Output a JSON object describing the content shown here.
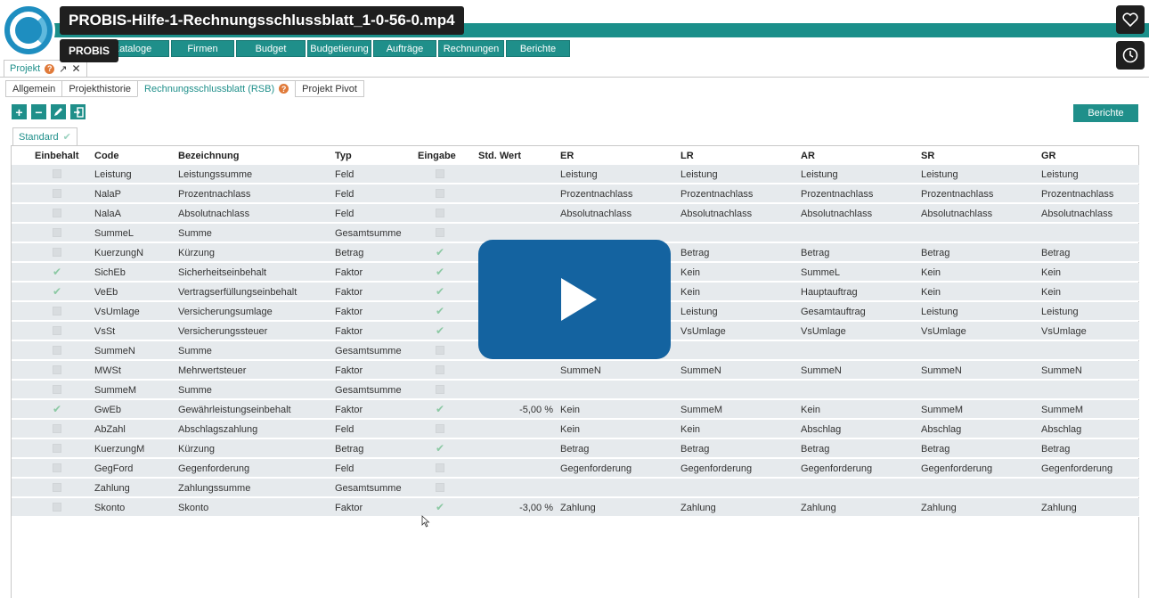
{
  "video": {
    "title": "PROBIS-Hilfe-1-Rechnungsschlussblatt_1-0-56-0.mp4",
    "channel": "PROBIS"
  },
  "nav": [
    "Kataloge",
    "Firmen",
    "Budget",
    "Budgetierung",
    "Aufträge",
    "Rechnungen",
    "Berichte"
  ],
  "doc_tab": {
    "label": "Projekt",
    "help": "?"
  },
  "subtabs": [
    {
      "label": "Allgemein"
    },
    {
      "label": "Projekthistorie"
    },
    {
      "label": "Rechnungsschlussblatt (RSB)",
      "help": "?"
    },
    {
      "label": "Projekt Pivot"
    }
  ],
  "toolbar": {
    "berichte": "Berichte"
  },
  "view_tab": {
    "label": "Standard"
  },
  "columns": [
    "Einbehalt",
    "Code",
    "Bezeichnung",
    "Typ",
    "Eingabe",
    "Std. Wert",
    "ER",
    "LR",
    "AR",
    "SR",
    "GR"
  ],
  "rows": [
    {
      "einbehalt": false,
      "code": "Leistung",
      "bez": "Leistungssumme",
      "typ": "Feld",
      "eingabe": false,
      "std": "",
      "er": "Leistung",
      "lr": "Leistung",
      "ar": "Leistung",
      "sr": "Leistung",
      "gr": "Leistung"
    },
    {
      "einbehalt": false,
      "code": "NalaP",
      "bez": "Prozentnachlass",
      "typ": "Feld",
      "eingabe": false,
      "std": "",
      "er": "Prozentnachlass",
      "lr": "Prozentnachlass",
      "ar": "Prozentnachlass",
      "sr": "Prozentnachlass",
      "gr": "Prozentnachlass"
    },
    {
      "einbehalt": false,
      "code": "NalaA",
      "bez": "Absolutnachlass",
      "typ": "Feld",
      "eingabe": false,
      "std": "",
      "er": "Absolutnachlass",
      "lr": "Absolutnachlass",
      "ar": "Absolutnachlass",
      "sr": "Absolutnachlass",
      "gr": "Absolutnachlass"
    },
    {
      "einbehalt": false,
      "code": "SummeL",
      "bez": "Summe",
      "typ": "Gesamtsumme",
      "eingabe": false,
      "std": "",
      "er": "",
      "lr": "",
      "ar": "",
      "sr": "",
      "gr": ""
    },
    {
      "einbehalt": false,
      "code": "KuerzungN",
      "bez": "Kürzung",
      "typ": "Betrag",
      "eingabe": true,
      "std": "",
      "er": "",
      "lr": "Betrag",
      "ar": "Betrag",
      "sr": "Betrag",
      "gr": "Betrag"
    },
    {
      "einbehalt": true,
      "code": "SichEb",
      "bez": "Sicherheitseinbehalt",
      "typ": "Faktor",
      "eingabe": true,
      "std": "",
      "er": "",
      "lr": "Kein",
      "ar": "SummeL",
      "sr": "Kein",
      "gr": "Kein"
    },
    {
      "einbehalt": true,
      "code": "VeEb",
      "bez": "Vertragserfüllungseinbehalt",
      "typ": "Faktor",
      "eingabe": true,
      "std": "",
      "er": "",
      "lr": "Kein",
      "ar": "Hauptauftrag",
      "sr": "Kein",
      "gr": "Kein"
    },
    {
      "einbehalt": false,
      "code": "VsUmlage",
      "bez": "Versicherungsumlage",
      "typ": "Faktor",
      "eingabe": true,
      "std": "",
      "er": "",
      "lr": "Leistung",
      "ar": "Gesamtauftrag",
      "sr": "Leistung",
      "gr": "Leistung"
    },
    {
      "einbehalt": false,
      "code": "VsSt",
      "bez": "Versicherungssteuer",
      "typ": "Faktor",
      "eingabe": true,
      "std": "",
      "er": "",
      "lr": "VsUmlage",
      "ar": "VsUmlage",
      "sr": "VsUmlage",
      "gr": "VsUmlage"
    },
    {
      "einbehalt": false,
      "code": "SummeN",
      "bez": "Summe",
      "typ": "Gesamtsumme",
      "eingabe": false,
      "std": "",
      "er": "",
      "lr": "",
      "ar": "",
      "sr": "",
      "gr": ""
    },
    {
      "einbehalt": false,
      "code": "MWSt",
      "bez": "Mehrwertsteuer",
      "typ": "Faktor",
      "eingabe": false,
      "std": "",
      "er": "SummeN",
      "lr": "SummeN",
      "ar": "SummeN",
      "sr": "SummeN",
      "gr": "SummeN"
    },
    {
      "einbehalt": false,
      "code": "SummeM",
      "bez": "Summe",
      "typ": "Gesamtsumme",
      "eingabe": false,
      "std": "",
      "er": "",
      "lr": "",
      "ar": "",
      "sr": "",
      "gr": ""
    },
    {
      "einbehalt": true,
      "code": "GwEb",
      "bez": "Gewährleistungseinbehalt",
      "typ": "Faktor",
      "eingabe": true,
      "std": "-5,00 %",
      "er": "Kein",
      "lr": "SummeM",
      "ar": "Kein",
      "sr": "SummeM",
      "gr": "SummeM"
    },
    {
      "einbehalt": false,
      "code": "AbZahl",
      "bez": "Abschlagszahlung",
      "typ": "Feld",
      "eingabe": false,
      "std": "",
      "er": "Kein",
      "lr": "Kein",
      "ar": "Abschlag",
      "sr": "Abschlag",
      "gr": "Abschlag"
    },
    {
      "einbehalt": false,
      "code": "KuerzungM",
      "bez": "Kürzung",
      "typ": "Betrag",
      "eingabe": true,
      "std": "",
      "er": "Betrag",
      "lr": "Betrag",
      "ar": "Betrag",
      "sr": "Betrag",
      "gr": "Betrag"
    },
    {
      "einbehalt": false,
      "code": "GegFord",
      "bez": "Gegenforderung",
      "typ": "Feld",
      "eingabe": false,
      "std": "",
      "er": "Gegenforderung",
      "lr": "Gegenforderung",
      "ar": "Gegenforderung",
      "sr": "Gegenforderung",
      "gr": "Gegenforderung"
    },
    {
      "einbehalt": false,
      "code": "Zahlung",
      "bez": "Zahlungssumme",
      "typ": "Gesamtsumme",
      "eingabe": false,
      "std": "",
      "er": "",
      "lr": "",
      "ar": "",
      "sr": "",
      "gr": ""
    },
    {
      "einbehalt": false,
      "code": "Skonto",
      "bez": "Skonto",
      "typ": "Faktor",
      "eingabe": true,
      "std": "-3,00 %",
      "er": "Zahlung",
      "lr": "Zahlung",
      "ar": "Zahlung",
      "sr": "Zahlung",
      "gr": "Zahlung"
    }
  ]
}
